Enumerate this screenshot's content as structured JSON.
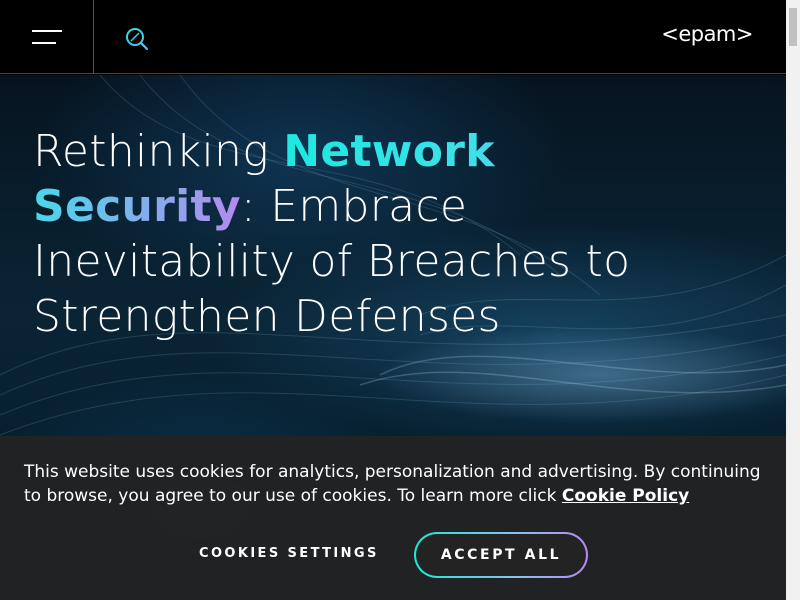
{
  "header": {
    "logo_text": "<epam>"
  },
  "hero": {
    "title_part1": "Rethinking ",
    "title_highlight": "Network Security",
    "title_part2": ": Embrace Inevitability of Breaches to Strengthen Defenses"
  },
  "cookie_banner": {
    "message": "This website uses cookies for analytics, personalization and advertising. By continuing to browse, you agree to our use of cookies. To learn more click ",
    "policy_link": "Cookie Policy",
    "settings_button": "COOKIES SETTINGS",
    "accept_button": "ACCEPT ALL"
  },
  "colors": {
    "accent_cyan": "#1ee8e0",
    "accent_purple": "#b48af0",
    "banner_bg": "#222222"
  }
}
